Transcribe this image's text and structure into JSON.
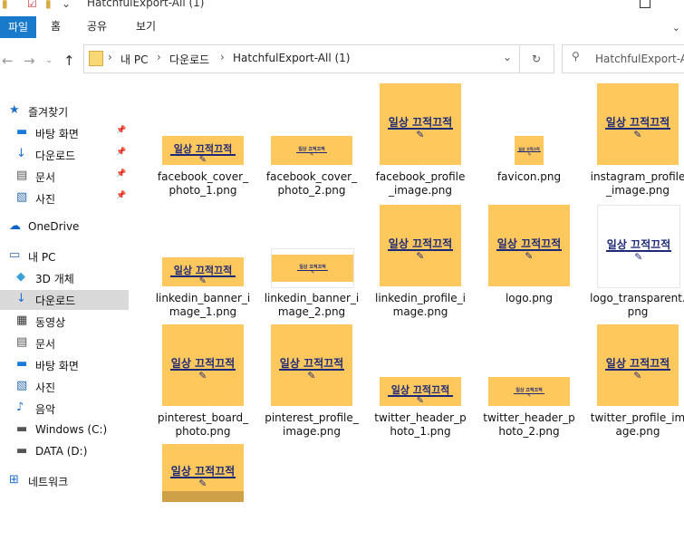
{
  "window": {
    "title": "HatchfulExport-All (1)"
  },
  "ribbon": {
    "tabs": [
      "파일",
      "홈",
      "공유",
      "보기"
    ]
  },
  "address": {
    "crumbs": [
      "내 PC",
      "다운로드",
      "HatchfulExport-All (1)"
    ]
  },
  "search": {
    "placeholder": "HatchfulExport-All"
  },
  "sidebar": {
    "items": [
      {
        "label": "즐겨찾기",
        "icon": "star-icon"
      },
      {
        "label": "바탕 화면",
        "icon": "desktop-icon",
        "pinned": true
      },
      {
        "label": "다운로드",
        "icon": "download-icon",
        "pinned": true
      },
      {
        "label": "문서",
        "icon": "document-icon",
        "pinned": true
      },
      {
        "label": "사진",
        "icon": "picture-icon",
        "pinned": true
      },
      {
        "label": "OneDrive",
        "icon": "cloud-icon"
      },
      {
        "label": "내 PC",
        "icon": "computer-icon"
      },
      {
        "label": "3D 개체",
        "icon": "cube-icon"
      },
      {
        "label": "다운로드",
        "icon": "download-icon",
        "selected": true
      },
      {
        "label": "동영상",
        "icon": "video-icon"
      },
      {
        "label": "문서",
        "icon": "document-icon"
      },
      {
        "label": "바탕 화면",
        "icon": "desktop-icon"
      },
      {
        "label": "사진",
        "icon": "picture-icon"
      },
      {
        "label": "음악",
        "icon": "music-icon"
      },
      {
        "label": "Windows (C:)",
        "icon": "drive-icon"
      },
      {
        "label": "DATA (D:)",
        "icon": "drive-icon"
      },
      {
        "label": "네트워크",
        "icon": "network-icon"
      }
    ]
  },
  "logo_text": "일상 끄적끄적",
  "files": [
    {
      "line1": "facebook_cover_",
      "line2": "photo_1.png",
      "thumb": "wide"
    },
    {
      "line1": "facebook_cover_",
      "line2": "photo_2.png",
      "thumb": "wide-small"
    },
    {
      "line1": "facebook_profile",
      "line2": "_image.png",
      "thumb": "square"
    },
    {
      "line1": "favicon.png",
      "line2": "",
      "thumb": "tiny"
    },
    {
      "line1": "instagram_profile",
      "line2": "_image.png",
      "thumb": "square"
    },
    {
      "line1": "linkedin_banner_i",
      "line2": "mage_1.png",
      "thumb": "wide"
    },
    {
      "line1": "linkedin_banner_i",
      "line2": "mage_2.png",
      "thumb": "banner-small"
    },
    {
      "line1": "linkedin_profile_i",
      "line2": "mage.png",
      "thumb": "square"
    },
    {
      "line1": "logo.png",
      "line2": "",
      "thumb": "square"
    },
    {
      "line1": "logo_transparent.",
      "line2": "png",
      "thumb": "square-white"
    },
    {
      "line1": "pinterest_board_",
      "line2": "photo.png",
      "thumb": "square"
    },
    {
      "line1": "pinterest_profile_",
      "line2": "image.png",
      "thumb": "square"
    },
    {
      "line1": "twitter_header_p",
      "line2": "hoto_1.png",
      "thumb": "strip"
    },
    {
      "line1": "twitter_header_p",
      "line2": "hoto_2.png",
      "thumb": "strip-small"
    },
    {
      "line1": "twitter_profile_im",
      "line2": "age.png",
      "thumb": "square"
    },
    {
      "line1": "",
      "line2": "",
      "thumb": "square-cut"
    }
  ]
}
